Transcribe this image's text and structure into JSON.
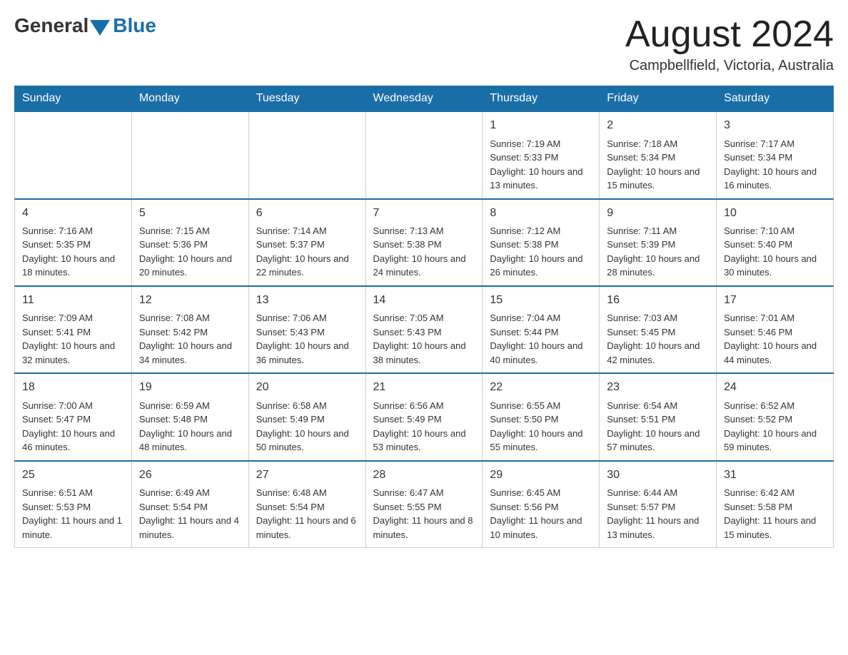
{
  "logo": {
    "text_general": "General",
    "text_blue": "Blue"
  },
  "title": {
    "month_year": "August 2024",
    "location": "Campbellfield, Victoria, Australia"
  },
  "weekdays": [
    "Sunday",
    "Monday",
    "Tuesday",
    "Wednesday",
    "Thursday",
    "Friday",
    "Saturday"
  ],
  "rows": [
    [
      {
        "day": "",
        "info": ""
      },
      {
        "day": "",
        "info": ""
      },
      {
        "day": "",
        "info": ""
      },
      {
        "day": "",
        "info": ""
      },
      {
        "day": "1",
        "info": "Sunrise: 7:19 AM\nSunset: 5:33 PM\nDaylight: 10 hours and 13 minutes."
      },
      {
        "day": "2",
        "info": "Sunrise: 7:18 AM\nSunset: 5:34 PM\nDaylight: 10 hours and 15 minutes."
      },
      {
        "day": "3",
        "info": "Sunrise: 7:17 AM\nSunset: 5:34 PM\nDaylight: 10 hours and 16 minutes."
      }
    ],
    [
      {
        "day": "4",
        "info": "Sunrise: 7:16 AM\nSunset: 5:35 PM\nDaylight: 10 hours and 18 minutes."
      },
      {
        "day": "5",
        "info": "Sunrise: 7:15 AM\nSunset: 5:36 PM\nDaylight: 10 hours and 20 minutes."
      },
      {
        "day": "6",
        "info": "Sunrise: 7:14 AM\nSunset: 5:37 PM\nDaylight: 10 hours and 22 minutes."
      },
      {
        "day": "7",
        "info": "Sunrise: 7:13 AM\nSunset: 5:38 PM\nDaylight: 10 hours and 24 minutes."
      },
      {
        "day": "8",
        "info": "Sunrise: 7:12 AM\nSunset: 5:38 PM\nDaylight: 10 hours and 26 minutes."
      },
      {
        "day": "9",
        "info": "Sunrise: 7:11 AM\nSunset: 5:39 PM\nDaylight: 10 hours and 28 minutes."
      },
      {
        "day": "10",
        "info": "Sunrise: 7:10 AM\nSunset: 5:40 PM\nDaylight: 10 hours and 30 minutes."
      }
    ],
    [
      {
        "day": "11",
        "info": "Sunrise: 7:09 AM\nSunset: 5:41 PM\nDaylight: 10 hours and 32 minutes."
      },
      {
        "day": "12",
        "info": "Sunrise: 7:08 AM\nSunset: 5:42 PM\nDaylight: 10 hours and 34 minutes."
      },
      {
        "day": "13",
        "info": "Sunrise: 7:06 AM\nSunset: 5:43 PM\nDaylight: 10 hours and 36 minutes."
      },
      {
        "day": "14",
        "info": "Sunrise: 7:05 AM\nSunset: 5:43 PM\nDaylight: 10 hours and 38 minutes."
      },
      {
        "day": "15",
        "info": "Sunrise: 7:04 AM\nSunset: 5:44 PM\nDaylight: 10 hours and 40 minutes."
      },
      {
        "day": "16",
        "info": "Sunrise: 7:03 AM\nSunset: 5:45 PM\nDaylight: 10 hours and 42 minutes."
      },
      {
        "day": "17",
        "info": "Sunrise: 7:01 AM\nSunset: 5:46 PM\nDaylight: 10 hours and 44 minutes."
      }
    ],
    [
      {
        "day": "18",
        "info": "Sunrise: 7:00 AM\nSunset: 5:47 PM\nDaylight: 10 hours and 46 minutes."
      },
      {
        "day": "19",
        "info": "Sunrise: 6:59 AM\nSunset: 5:48 PM\nDaylight: 10 hours and 48 minutes."
      },
      {
        "day": "20",
        "info": "Sunrise: 6:58 AM\nSunset: 5:49 PM\nDaylight: 10 hours and 50 minutes."
      },
      {
        "day": "21",
        "info": "Sunrise: 6:56 AM\nSunset: 5:49 PM\nDaylight: 10 hours and 53 minutes."
      },
      {
        "day": "22",
        "info": "Sunrise: 6:55 AM\nSunset: 5:50 PM\nDaylight: 10 hours and 55 minutes."
      },
      {
        "day": "23",
        "info": "Sunrise: 6:54 AM\nSunset: 5:51 PM\nDaylight: 10 hours and 57 minutes."
      },
      {
        "day": "24",
        "info": "Sunrise: 6:52 AM\nSunset: 5:52 PM\nDaylight: 10 hours and 59 minutes."
      }
    ],
    [
      {
        "day": "25",
        "info": "Sunrise: 6:51 AM\nSunset: 5:53 PM\nDaylight: 11 hours and 1 minute."
      },
      {
        "day": "26",
        "info": "Sunrise: 6:49 AM\nSunset: 5:54 PM\nDaylight: 11 hours and 4 minutes."
      },
      {
        "day": "27",
        "info": "Sunrise: 6:48 AM\nSunset: 5:54 PM\nDaylight: 11 hours and 6 minutes."
      },
      {
        "day": "28",
        "info": "Sunrise: 6:47 AM\nSunset: 5:55 PM\nDaylight: 11 hours and 8 minutes."
      },
      {
        "day": "29",
        "info": "Sunrise: 6:45 AM\nSunset: 5:56 PM\nDaylight: 11 hours and 10 minutes."
      },
      {
        "day": "30",
        "info": "Sunrise: 6:44 AM\nSunset: 5:57 PM\nDaylight: 11 hours and 13 minutes."
      },
      {
        "day": "31",
        "info": "Sunrise: 6:42 AM\nSunset: 5:58 PM\nDaylight: 11 hours and 15 minutes."
      }
    ]
  ]
}
